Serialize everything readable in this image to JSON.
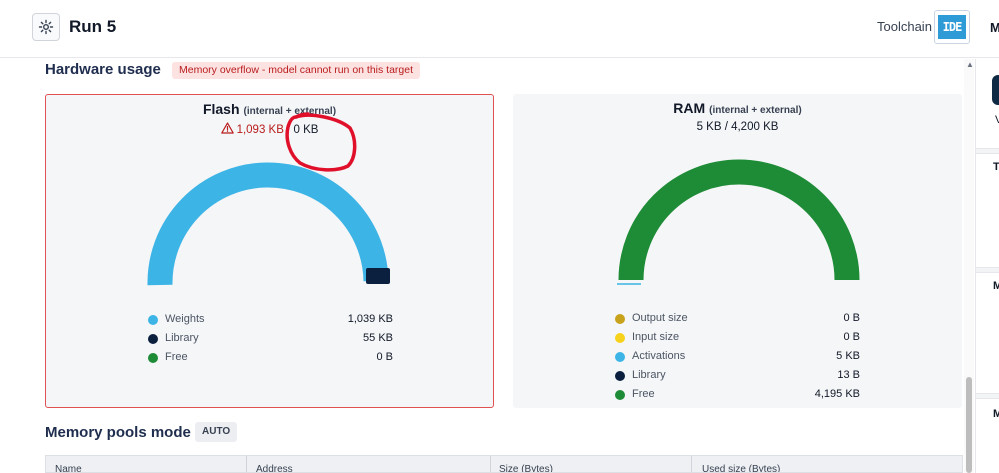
{
  "header": {
    "title": "Run 5",
    "toolchain_label": "Toolchain",
    "ide_label": "IDE",
    "cut_menu_letter": "M"
  },
  "hardware": {
    "title": "Hardware usage",
    "overflow_badge": "Memory overflow - model cannot run on this target",
    "flash": {
      "title": "Flash",
      "subtitle": "(internal + external)",
      "warning_icon": "warning-triangle-icon",
      "used": "1,093 KB",
      "separator": " / ",
      "total": "0 KB",
      "legend": [
        {
          "label": "Weights",
          "value": "1,039 KB",
          "color": "#3db4e6"
        },
        {
          "label": "Library",
          "value": "55 KB",
          "color": "#0b1f3f"
        },
        {
          "label": "Free",
          "value": "0 B",
          "color": "#1e8c36"
        }
      ]
    },
    "ram": {
      "title": "RAM",
      "subtitle": "(internal + external)",
      "usage": "5 KB / 4,200 KB",
      "legend": [
        {
          "label": "Output size",
          "value": "0 B",
          "color": "#c8a21a"
        },
        {
          "label": "Input size",
          "value": "0 B",
          "color": "#f7d21c"
        },
        {
          "label": "Activations",
          "value": "5 KB",
          "color": "#3db4e6"
        },
        {
          "label": "Library",
          "value": "13 B",
          "color": "#0b1f3f"
        },
        {
          "label": "Free",
          "value": "4,195 KB",
          "color": "#1e8c36"
        }
      ]
    }
  },
  "pools": {
    "title": "Memory pools mode",
    "mode_badge": "AUTO",
    "columns": [
      "Name",
      "Address",
      "Size (Bytes)",
      "Used size (Bytes)"
    ]
  },
  "right_panel": {
    "letters": [
      "V",
      "T",
      "M",
      "M"
    ]
  },
  "colors": {
    "accent_blue": "#3db4e6",
    "navy": "#0b1f3f",
    "green": "#1e8c36",
    "error_red": "#b91c1c",
    "annotation_red": "#e0102a"
  }
}
